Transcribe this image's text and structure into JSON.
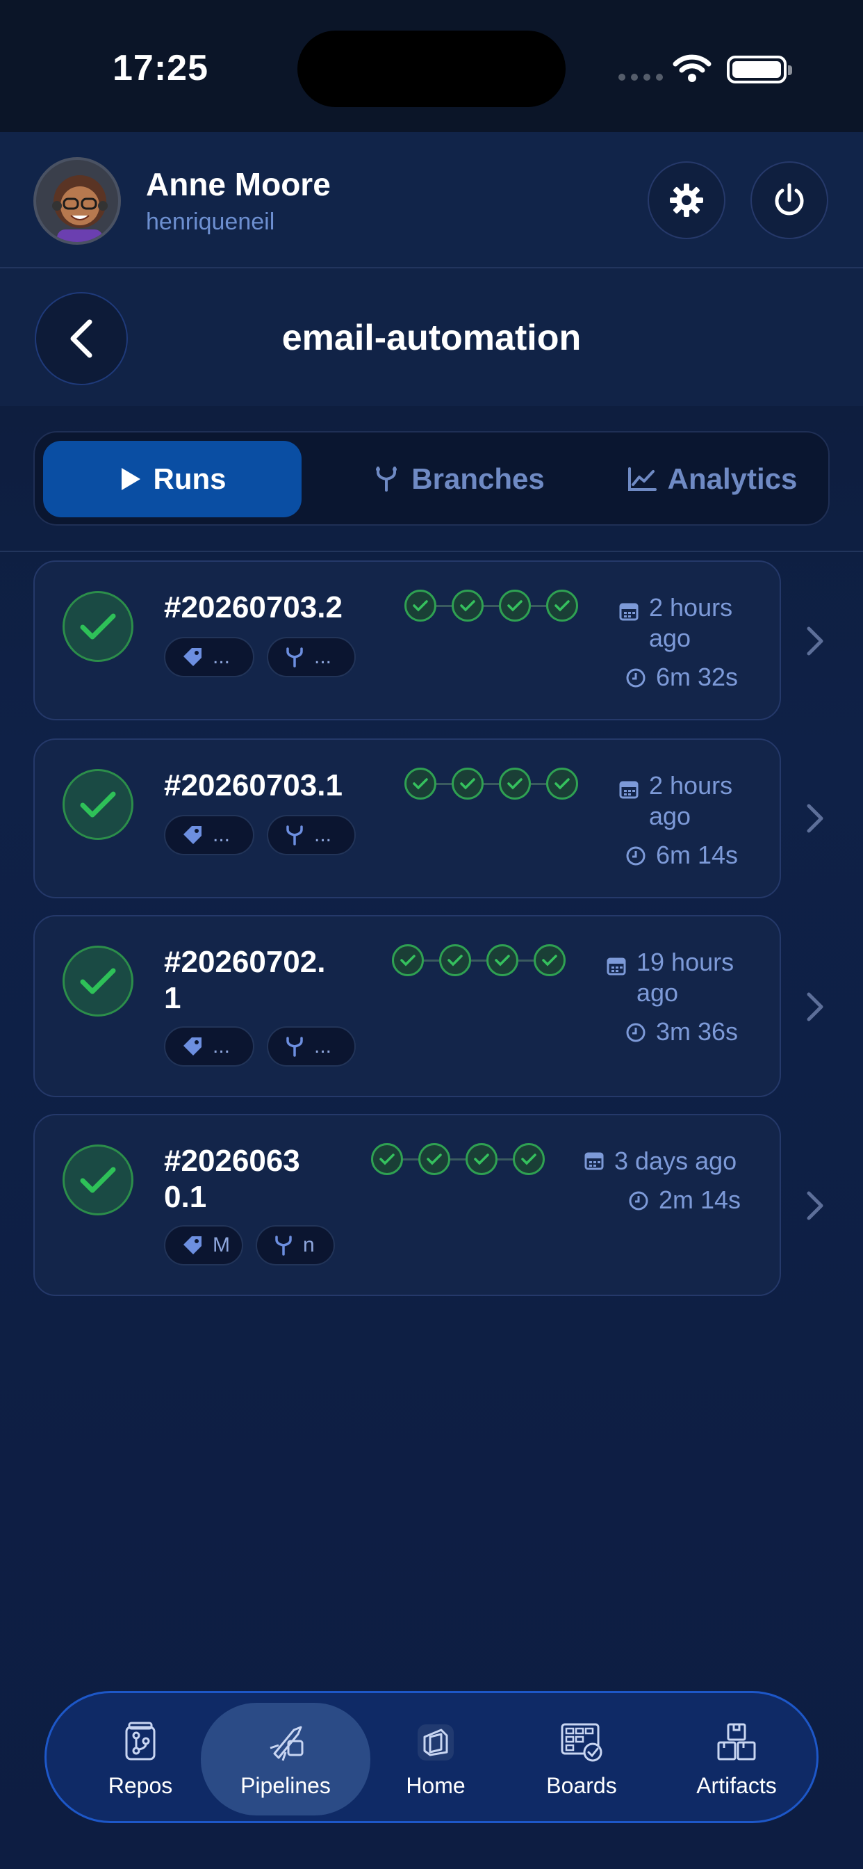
{
  "status_bar": {
    "time": "17:25"
  },
  "user": {
    "name": "Anne Moore",
    "handle": "henriqueneil"
  },
  "header": {
    "title": "email-automation"
  },
  "tabs": [
    {
      "label": "Runs",
      "icon": "play-icon",
      "active": true
    },
    {
      "label": "Branches",
      "icon": "branch-icon",
      "active": false
    },
    {
      "label": "Analytics",
      "icon": "chart-icon",
      "active": false
    }
  ],
  "runs": [
    {
      "number_lines": [
        "#20260703.2"
      ],
      "tag_chip": "...",
      "branch_chip": "...",
      "stages": 4,
      "time_ago": [
        "2 hours",
        "ago"
      ],
      "duration": "6m 32s",
      "status": "succeeded"
    },
    {
      "number_lines": [
        "#20260703.1"
      ],
      "tag_chip": "...",
      "branch_chip": "...",
      "stages": 4,
      "time_ago": [
        "2 hours",
        "ago"
      ],
      "duration": "6m 14s",
      "status": "succeeded"
    },
    {
      "number_lines": [
        "#20260702.",
        "1"
      ],
      "tag_chip": "...",
      "branch_chip": "...",
      "stages": 4,
      "time_ago": [
        "19 hours",
        "ago"
      ],
      "duration": "3m 36s",
      "status": "succeeded"
    },
    {
      "number_lines": [
        "#2026063",
        "0.1"
      ],
      "tag_chip": "M",
      "branch_chip": "n",
      "stages": 4,
      "time_ago": [
        "3 days ago"
      ],
      "duration": "2m 14s",
      "status": "succeeded"
    }
  ],
  "nav": [
    {
      "label": "Repos",
      "icon": "repo-icon",
      "active": false
    },
    {
      "label": "Pipelines",
      "icon": "pipeline-icon",
      "active": true
    },
    {
      "label": "Home",
      "icon": "home-icon",
      "active": false
    },
    {
      "label": "Boards",
      "icon": "boards-icon",
      "active": false
    },
    {
      "label": "Artifacts",
      "icon": "artifacts-icon",
      "active": false
    }
  ],
  "colors": {
    "accent": "#0a4ea3",
    "success": "#2fa152",
    "muted_text": "#7d9ad8",
    "nav_border": "#1d57c8"
  }
}
